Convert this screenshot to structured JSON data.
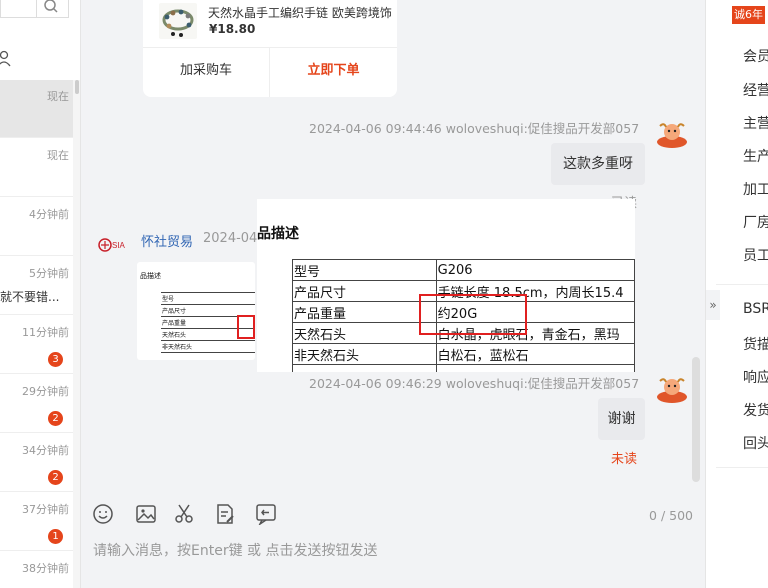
{
  "conversations": [
    {
      "time": "现在",
      "snippet": "",
      "badge": ""
    },
    {
      "time": "现在",
      "snippet": "",
      "badge": ""
    },
    {
      "time": "4分钟前",
      "snippet": "",
      "badge": ""
    },
    {
      "time": "5分钟前",
      "snippet": "就不要错...",
      "badge": ""
    },
    {
      "time": "11分钟前",
      "snippet": "",
      "badge": "3"
    },
    {
      "time": "29分钟前",
      "snippet": "",
      "badge": "2"
    },
    {
      "time": "34分钟前",
      "snippet": "",
      "badge": "2"
    },
    {
      "time": "37分钟前",
      "snippet": "",
      "badge": "1"
    },
    {
      "time": "38分钟前",
      "snippet": "",
      "badge": ""
    }
  ],
  "product_card": {
    "title": "天然水晶手工编织手链 欧美跨境饰",
    "price": "¥18.80",
    "add_cart_label": "加采购车",
    "buy_now_label": "立即下单"
  },
  "messages": {
    "first": {
      "meta": "2024-04-06 09:44:46  woloveshuqi:促佳搜品开发部057",
      "text": "这款多重呀",
      "status": "已读"
    },
    "other": {
      "name": "怀社贸易",
      "time": "2024-04"
    },
    "second": {
      "meta": "2024-04-06 09:46:29  woloveshuqi:促佳搜品开发部057",
      "text": "谢谢",
      "status": "未读"
    }
  },
  "preview": {
    "title": "品描述",
    "rows": [
      {
        "k": "型号",
        "v": "G206"
      },
      {
        "k": "产品尺寸",
        "v": "手链长度  18.5cm，内周长15.4"
      },
      {
        "k": "产品重量",
        "v": "约20G"
      },
      {
        "k": "天然石头",
        "v": "白水晶，虎眼石，青金石，黑玛"
      },
      {
        "k": "非天然石头",
        "v": "白松石，蓝松石"
      },
      {
        "k": "",
        "v": ""
      }
    ]
  },
  "thumb": {
    "title": "品描述",
    "rows": [
      "型号",
      "产品尺寸",
      "产品重量",
      "天然石头",
      "非天然石头"
    ]
  },
  "input": {
    "placeholder": "请输入消息，按Enter键 或 点击发送按钮发送",
    "char_count": "0 / 500"
  },
  "right_panel": {
    "badge": "诚6年",
    "items_top": [
      "会员",
      "经营",
      "主营",
      "生产",
      "加工",
      "厂房",
      "员工"
    ],
    "items_bottom": [
      "BSR",
      "货描",
      "响应",
      "发货",
      "回头"
    ]
  },
  "colors": {
    "accent": "#e5451b",
    "link": "#3367b4",
    "highlight_box": "#e02020"
  }
}
